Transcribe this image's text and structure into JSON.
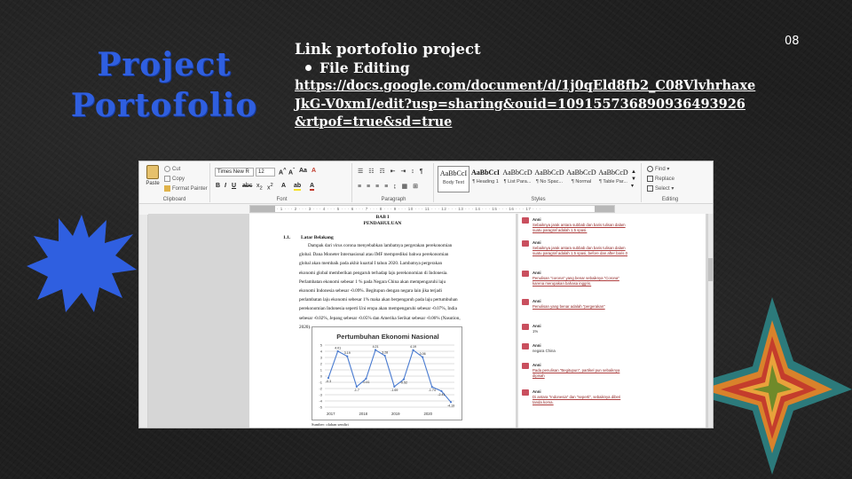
{
  "slide": {
    "title_line1": "Project",
    "title_line2": "Portofolio",
    "page_number": "08",
    "link_heading": "Link portofolio project",
    "bullet": "File Editing",
    "url": "https://docs.google.com/document/d/1j0qEld8fb2_C08VlvhrhaxeJkG-V0xmI/edit?usp=sharing&ouid=109155736890936493926&rtpof=true&sd=true",
    "colors": {
      "title": "#2f5fe0",
      "background": "#1f1f1f",
      "blue_star": "#2f5fe0"
    }
  },
  "word": {
    "ribbon": {
      "clipboard": {
        "paste": "Paste",
        "cut": "Cut",
        "copy": "Copy",
        "format_painter": "Format Painter",
        "label": "Clipboard"
      },
      "font": {
        "family": "Times New R",
        "size": "12",
        "label": "Font"
      },
      "paragraph": {
        "label": "Paragraph"
      },
      "styles": {
        "label": "Styles",
        "items": [
          {
            "sample": "AaBbCcI",
            "name": "Body Text"
          },
          {
            "sample": "AaBbCcI",
            "name": "¶ Heading 1"
          },
          {
            "sample": "AaBbCcD",
            "name": "¶ List Para..."
          },
          {
            "sample": "AaBbCcD",
            "name": "¶ No Spac..."
          },
          {
            "sample": "AaBbCcD",
            "name": "¶ Normal"
          },
          {
            "sample": "AaBbCcD",
            "name": "¶ Table Par..."
          }
        ]
      },
      "editing": {
        "find": "Find",
        "replace": "Replace",
        "select": "Select",
        "label": "Editing"
      }
    },
    "ruler_text": "· 1 · · · 2 · · · 3 · · · 4 · · · 5 · · · 6 · · · 7 · · · 8 · · · 9 · · · 10 · · · 11 · · · 12 · · · 13 · · · 14 · · · 15 · · · 16 · · · 17 · · ·",
    "document": {
      "bab": "BAB I",
      "bab_title": "PENDAHULUAN",
      "section_num": "1.1.",
      "section_title": "Latar Belakang",
      "lines": [
        "Dampak dari virus corona menyebabkan lambatnya pergerakan perekonomian",
        "global. Dana Moneter Internasional atau IMF memprediksi bahwa perekonomian",
        "global akan membaik pada akhir kuartal I tahun 2020. Lambatnya pergerakan",
        "ekonomi global memberikan pengaruh terhadap laju perekonomian di Indonesia.",
        "Perlambatan ekonomi sebesar 1 % pada Negara China akan mempengaruhi laju",
        "ekonomi Indonesia sebesar -0.09%. Begitupun dengan negara lain jika terjadi",
        "perlambatan laju ekonomi sebesar 1% maka akan berpengaruh pada laju pertumbuhan",
        "perekonomian Indonesia seperti Uni eropa akan mempengaruhi sebesar -0.07%, India",
        "sebesar -0.02%, Jepang sebesar -0.05% dan Amerika Serikat sebesar -0.06% (Nasution,",
        "2020)."
      ],
      "source": "Sumber: olahan sendiri"
    },
    "comments": [
      {
        "author": "Anni",
        "text": "Sebaiknya jarak antara subbab dan baris tulisan dalam suatu paragraf adalah 1,5 spasi."
      },
      {
        "author": "Anni",
        "text": "Sebaiknya jarak antara subbab dan baris tulisan dalam suatu paragraf adalah 1,5 spasi, before dan after baris 0"
      },
      {
        "author": "Anni",
        "text": "Penulisan \"corona\" yang benar sebaiknya \"Corona\" karena merupakan bahasa inggris."
      },
      {
        "author": "Anni",
        "text": "Penulisan yang benar adalah \"pergerakan\""
      },
      {
        "author": "Anni",
        "text": "1%"
      },
      {
        "author": "Anni",
        "text": "negara China"
      },
      {
        "author": "Anni",
        "text": "Pada penulisan \"Begitupun\", partikel pun sebaiknya dipisah"
      },
      {
        "author": "Anni",
        "text": "Di antara \"Indonesia\" dan \"seperti\", sebaiknya diberi tanda koma."
      }
    ]
  },
  "chart_data": {
    "type": "line",
    "title": "Pertumbuhan Ekonomi Nasional",
    "x_ticks": [
      "2017",
      "2018",
      "2019",
      "2020"
    ],
    "ylim": [
      -5,
      5
    ],
    "y_ticks": [
      5,
      4,
      3,
      2,
      1,
      0,
      -1,
      -2,
      -3,
      -4,
      -5
    ],
    "grid": true,
    "series": [
      {
        "values": [
          -0.3,
          4.01,
          3.19,
          -1.7,
          -0.41,
          4.21,
          3.28,
          -1.69,
          -0.52,
          4.19,
          3.06,
          -1.74,
          -2.41,
          -4.19
        ],
        "labels": [
          "-0.3",
          "4.01",
          "3.19",
          "-1.7",
          "-0.41",
          "4.21",
          "3.28",
          "-1.69",
          "-0.52",
          "4.19",
          "3.06",
          "-1.74",
          "-2.41",
          "-4.19"
        ]
      }
    ],
    "color": "#4a7bd0"
  }
}
